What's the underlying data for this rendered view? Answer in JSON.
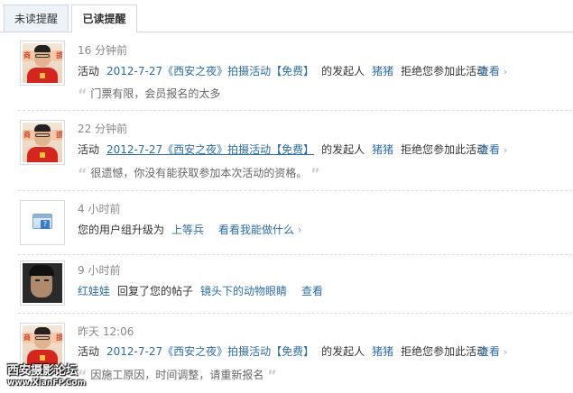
{
  "tabs": [
    {
      "label": "未读提醒",
      "active": false
    },
    {
      "label": "已读提醒",
      "active": true
    }
  ],
  "notifications": [
    {
      "time": "16 分钟前",
      "prefix": "活动",
      "activity_link": "2012-7-27《西安之夜》拍摄活动【免费】",
      "middle": "的发起人",
      "user": "猪猪",
      "action": "拒绝您参加此活动",
      "view_label": "查看",
      "message": "门票有限，会员报名的太多"
    },
    {
      "time": "22 分钟前",
      "prefix": "活动",
      "activity_link": "2012-7-27《西安之夜》拍摄活动【免费】",
      "middle": "的发起人",
      "user": "猪猪",
      "action": "拒绝您参加此活动",
      "view_label": "查看",
      "message": "很遗憾，你没有能获取参加本次活动的资格。"
    },
    {
      "time": "4 小时前",
      "prefix": "您的用户组升级为",
      "group": "上等兵",
      "privilege_link": "看看我能做什么"
    },
    {
      "time": "9 小时前",
      "user": "红娃娃",
      "action": "回复了您的帖子",
      "post_link": "镜头下的动物眼睛",
      "view_label": "查看"
    },
    {
      "time": "昨天 12:06",
      "prefix": "活动",
      "activity_link": "2012-7-27《西安之夜》拍摄活动【免费】",
      "middle": "的发起人",
      "user": "猪猪",
      "action": "拒绝您参加此活动",
      "view_label": "查看",
      "message": "因施工原因，时间调整，请重新报名"
    }
  ],
  "watermark": {
    "name": "西安摄影论坛",
    "url": "www.XianFP.Com"
  },
  "colors": {
    "link": "#2b6ea6",
    "muted": "#888888",
    "tab_border": "#cfd8e3"
  }
}
